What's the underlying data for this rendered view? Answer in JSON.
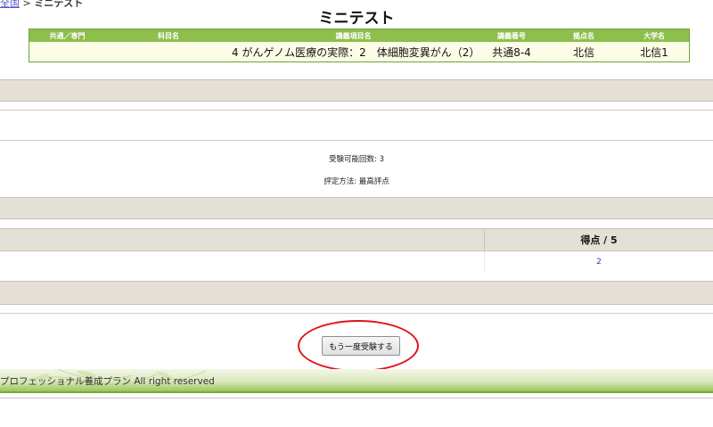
{
  "breadcrumb": {
    "link": "全国",
    "current": "ミニテスト"
  },
  "page_title": "ミニテスト",
  "course_table": {
    "headers": {
      "common": "共通／専門",
      "subject": "科目名",
      "item": "講義項目名",
      "lecture_no": "講義番号",
      "base": "拠点名",
      "university": "大学名"
    },
    "row": {
      "common": "",
      "subject": "",
      "item": "4 がんゲノム医療の実際：2　体細胞変異がん（2）",
      "lecture_no": "共通8-4",
      "base": "北信",
      "university": "北信1"
    }
  },
  "info": {
    "attempts": "受験可能回数: 3",
    "grading": "評定方法: 最高評点"
  },
  "score": {
    "header": "得点 / 5",
    "value": "2"
  },
  "retry_button": "もう一度受験する",
  "footer_text": "プロフェッショナル養成プラン All right reserved",
  "colors": {
    "header_green": "#8cbf4c",
    "band_beige": "#e5e0d6",
    "highlight_red": "#e0121b"
  }
}
